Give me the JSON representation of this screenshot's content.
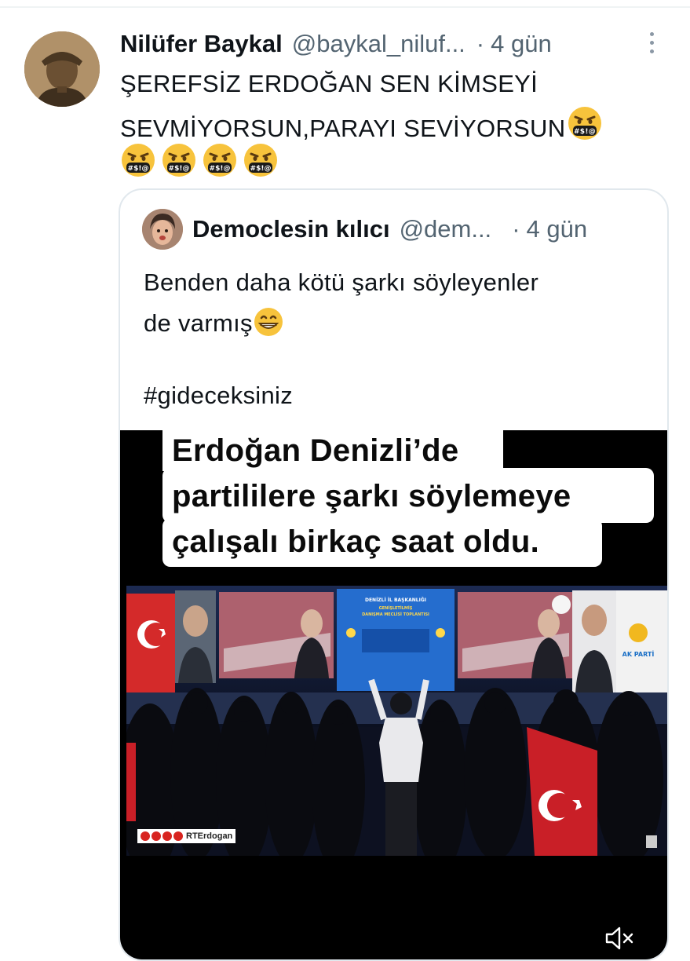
{
  "tweet": {
    "author_name": "Nilüfer Baykal",
    "handle": "@baykal_niluf...",
    "separator": "·",
    "time": "4 gün",
    "text_line1": "ŞEREFSİZ ERDOĞAN SEN KİMSEYİ",
    "text_line2": "SEVMİYORSUN,PARAYI SEVİYORSUN",
    "emoji": "face-with-symbols-on-mouth",
    "emoji_count_row": 4
  },
  "quote": {
    "author_name": "Democlesin kılıcı",
    "handle": "@dem...",
    "separator": "·",
    "time": "4 gün",
    "text_line1": "Benden daha kötü şarkı söyleyenler",
    "text_line2": "de varmış",
    "emoji": "grinning-face",
    "hashtag": "#gideceksiniz"
  },
  "video": {
    "caption_line1": "Erdoğan Denizli’de",
    "caption_line2": "partililere şarkı söylemeye",
    "caption_line3": "çalışalı birkaç saat oldu.",
    "watermark": "RTErdogan",
    "banner_text": "DENİZLİ İL BAŞKANLIĞI GENİŞLETİLMİŞ DANIŞMA MECLİSİ TOPLANTISI",
    "party_logo_text": "AK PARTİ",
    "mute_icon": "volume-muted-icon"
  },
  "colors": {
    "text": "#0f1419",
    "secondary": "#536471",
    "border": "#e1e8ed"
  }
}
